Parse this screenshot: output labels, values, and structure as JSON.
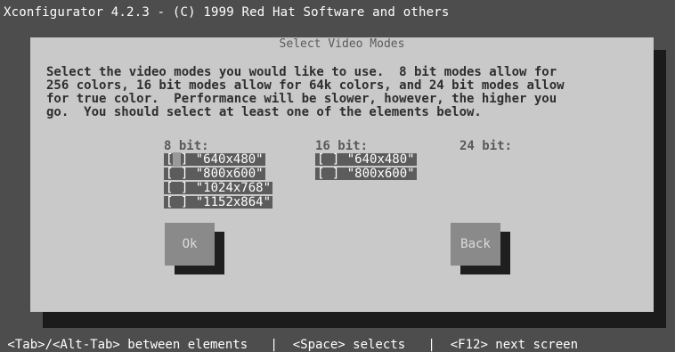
{
  "window": {
    "title": "Xconfigurator 4.2.3 - (C) 1999 Red Hat Software and others"
  },
  "dialog": {
    "title": "Select Video Modes",
    "instructions": "Select the video modes you would like to use.  8 bit modes allow for\n256 colors, 16 bit modes allow for 64k colors, and 24 bit modes allow\nfor true color.  Performance will be slower, however, the higher you\ngo.  You should select at least one of the elements below."
  },
  "modes": {
    "bit8": {
      "heading": "8 bit:",
      "options": [
        {
          "checkbox": "[ ]",
          "label": "\"640x480\""
        },
        {
          "checkbox": "[ ]",
          "label": "\"800x600\""
        },
        {
          "checkbox": "[ ]",
          "label": "\"1024x768\""
        },
        {
          "checkbox": "[ ]",
          "label": "\"1152x864\""
        }
      ]
    },
    "bit16": {
      "heading": "16 bit:",
      "options": [
        {
          "checkbox": "[ ]",
          "label": "\"640x480\""
        },
        {
          "checkbox": "[ ]",
          "label": "\"800x600\""
        }
      ]
    },
    "bit24": {
      "heading": "24 bit:",
      "options": []
    }
  },
  "buttons": {
    "ok": "Ok",
    "back": "Back"
  },
  "status_bar": {
    "text": " <Tab>/<Alt-Tab> between elements   |  <Space> selects   |  <F12> next screen"
  },
  "colors": {
    "screen_background": "#4d4d4d",
    "dialog_background": "#c9c9c9",
    "option_background": "#5c5c5c",
    "button_background": "#8a8a8a",
    "shadow": "#1b1b1b"
  }
}
